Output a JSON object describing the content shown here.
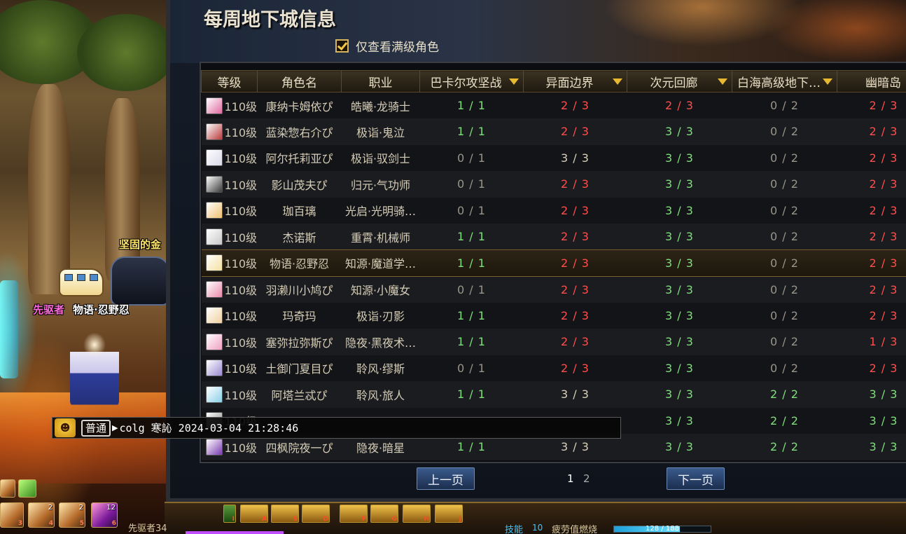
{
  "panel": {
    "title": "每周地下城信息",
    "filter_label": "仅查看满级角色",
    "filter_checked": true
  },
  "table": {
    "columns": [
      "等级",
      "角色名",
      "职业",
      "巴卡尔攻坚战",
      "异面边界",
      "次元回廊",
      "白海高级地下…",
      "幽暗岛"
    ],
    "rows": [
      {
        "level": "110级",
        "name": "康纳卡姆依ぴ",
        "job": "皓曦·龙骑士",
        "bakal": "1 / 1",
        "yimian": "2 / 3",
        "ciyuan": "2 / 3",
        "baihai": "0 / 2",
        "youan": "2 / 3",
        "portrait": "#e06aa0"
      },
      {
        "level": "110级",
        "name": "蓝染惣右介ぴ",
        "job": "极诣·鬼泣",
        "bakal": "1 / 1",
        "yimian": "2 / 3",
        "ciyuan": "3 / 3",
        "baihai": "0 / 2",
        "youan": "2 / 3",
        "portrait": "#b83a3a"
      },
      {
        "level": "110级",
        "name": "阿尔托莉亚ぴ",
        "job": "极诣·驭剑士",
        "bakal": "0 / 1",
        "yimian": "3 / 3",
        "ciyuan": "3 / 3",
        "baihai": "0 / 2",
        "youan": "2 / 3",
        "portrait": "#d8d8e8"
      },
      {
        "level": "110级",
        "name": "影山茂夫ぴ",
        "job": "归元·气功师",
        "bakal": "0 / 1",
        "yimian": "2 / 3",
        "ciyuan": "3 / 3",
        "baihai": "0 / 2",
        "youan": "2 / 3",
        "portrait": "#3a3a3a"
      },
      {
        "level": "110级",
        "name": "珈百璃",
        "job": "光启·光明骑…",
        "bakal": "0 / 1",
        "yimian": "2 / 3",
        "ciyuan": "3 / 3",
        "baihai": "0 / 2",
        "youan": "2 / 3",
        "portrait": "#f0c070"
      },
      {
        "level": "110级",
        "name": "杰诺斯",
        "job": "重霄·机械师",
        "bakal": "1 / 1",
        "yimian": "2 / 3",
        "ciyuan": "3 / 3",
        "baihai": "0 / 2",
        "youan": "2 / 3",
        "portrait": "#c8c8c8"
      },
      {
        "level": "110级",
        "name": "物语·忍野忍",
        "job": "知源·魔道学…",
        "bakal": "1 / 1",
        "yimian": "2 / 3",
        "ciyuan": "3 / 3",
        "baihai": "0 / 2",
        "youan": "2 / 3",
        "portrait": "#f4e0a0",
        "selected": true
      },
      {
        "level": "110级",
        "name": "羽濑川小鸠ぴ",
        "job": "知源·小魔女",
        "bakal": "0 / 1",
        "yimian": "2 / 3",
        "ciyuan": "3 / 3",
        "baihai": "0 / 2",
        "youan": "2 / 3",
        "portrait": "#e88aa8"
      },
      {
        "level": "110级",
        "name": "玛奇玛",
        "job": "极诣·刃影",
        "bakal": "1 / 1",
        "yimian": "2 / 3",
        "ciyuan": "3 / 3",
        "baihai": "0 / 2",
        "youan": "2 / 3",
        "portrait": "#f0d0a0"
      },
      {
        "level": "110级",
        "name": "塞弥拉弥斯ぴ",
        "job": "隐夜·黑夜术…",
        "bakal": "1 / 1",
        "yimian": "2 / 3",
        "ciyuan": "3 / 3",
        "baihai": "0 / 2",
        "youan": "1 / 3",
        "portrait": "#f0a0c0"
      },
      {
        "level": "110级",
        "name": "土御门夏目ぴ",
        "job": "聆风·缪斯",
        "bakal": "0 / 1",
        "yimian": "2 / 3",
        "ciyuan": "3 / 3",
        "baihai": "0 / 2",
        "youan": "2 / 3",
        "portrait": "#9a8ad0"
      },
      {
        "level": "110级",
        "name": "阿塔兰忒ぴ",
        "job": "聆风·旅人",
        "bakal": "1 / 1",
        "yimian": "3 / 3",
        "ciyuan": "3 / 3",
        "baihai": "2 / 2",
        "youan": "3 / 3",
        "portrait": "#8ad0e8"
      },
      {
        "level": "110级",
        "name": "",
        "job": "",
        "bakal": "",
        "yimian": "",
        "ciyuan": "3 / 3",
        "baihai": "2 / 2",
        "youan": "3 / 3",
        "portrait": "#888888"
      },
      {
        "level": "110级",
        "name": "四枫院夜一ぴ",
        "job": "隐夜·暗星",
        "bakal": "1 / 1",
        "yimian": "3 / 3",
        "ciyuan": "3 / 3",
        "baihai": "2 / 2",
        "youan": "3 / 3",
        "portrait": "#7a3ab0"
      }
    ]
  },
  "pager": {
    "prev": "上一页",
    "next": "下一页",
    "pages": [
      "1",
      "2"
    ],
    "current": "1"
  },
  "chat": {
    "icon": "smile-icon",
    "channel": "普通",
    "text": "colg 寒訫 2024-03-04 21:28:46"
  },
  "scene": {
    "vehicle_label": "坚固的金",
    "rank_label": "先驱者",
    "char_label": "物语·忍野忍"
  },
  "hud": {
    "left_counts": [
      "",
      "2",
      "2",
      "12"
    ],
    "left_keys": [
      "3",
      "4",
      "5",
      "6"
    ],
    "skill_keys": [
      "I",
      "A",
      "S",
      "D",
      "F",
      "G",
      "H",
      "J"
    ],
    "level_label": "先驱者34",
    "skill_label": "技能",
    "skill_points": "10",
    "fatigue_label": "疲劳值燃烧",
    "fatigue_text": "128 / 188",
    "fatigue_fraction": 0.68
  },
  "colors": {
    "green": "#7ee07a",
    "red": "#ff4e4e",
    "gray": "#9a958b",
    "white": "#d8d0bc",
    "accent": "#e8b830"
  }
}
